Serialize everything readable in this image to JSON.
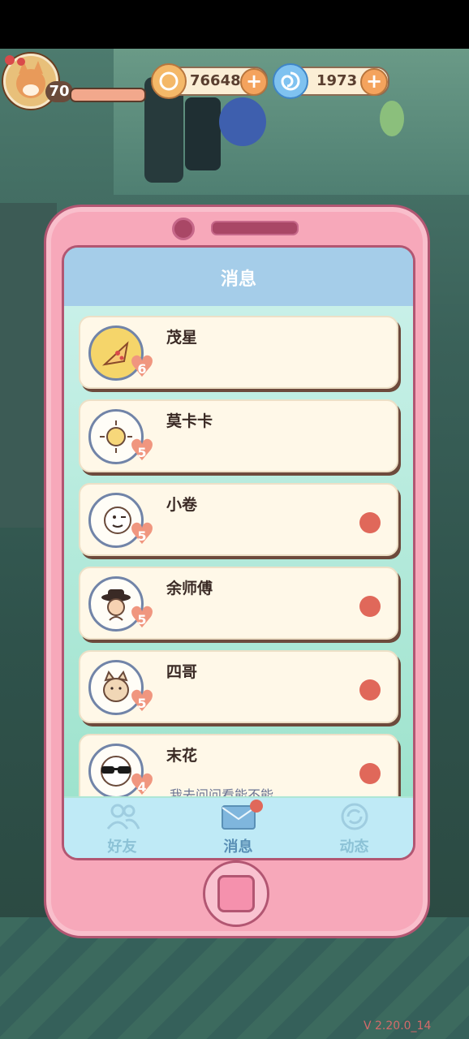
{
  "hud": {
    "level": "70",
    "coins": "76648",
    "gems": "1973"
  },
  "screen": {
    "title": "消息"
  },
  "messages": [
    {
      "name": "茂星",
      "hearts": "6",
      "avatar_icon": "pizza-icon",
      "unread": false,
      "preview": ""
    },
    {
      "name": "莫卡卡",
      "hearts": "5",
      "avatar_icon": "sun-icon",
      "unread": false,
      "preview": ""
    },
    {
      "name": "小卷",
      "hearts": "5",
      "avatar_icon": "winking-face-icon",
      "unread": true,
      "preview": ""
    },
    {
      "name": "余师傅",
      "hearts": "5",
      "avatar_icon": "hat-man-icon",
      "unread": true,
      "preview": ""
    },
    {
      "name": "四哥",
      "hearts": "5",
      "avatar_icon": "cat-icon",
      "unread": true,
      "preview": ""
    },
    {
      "name": "末花",
      "hearts": "4",
      "avatar_icon": "sunglasses-face-icon",
      "unread": true,
      "preview": "我去问问看能不能..."
    }
  ],
  "tabs": [
    {
      "label": "好友",
      "icon": "friends-icon",
      "active": false
    },
    {
      "label": "消息",
      "icon": "envelope-icon",
      "active": true
    },
    {
      "label": "动态",
      "icon": "refresh-badge-icon",
      "active": false
    }
  ],
  "footer": {
    "version": "V 2.20.0_14"
  },
  "colors": {
    "phone_pink": "#f7a8ba",
    "header_blue": "#a5cde9",
    "unread_dot": "#e0685a",
    "heart": "#f0967f"
  }
}
